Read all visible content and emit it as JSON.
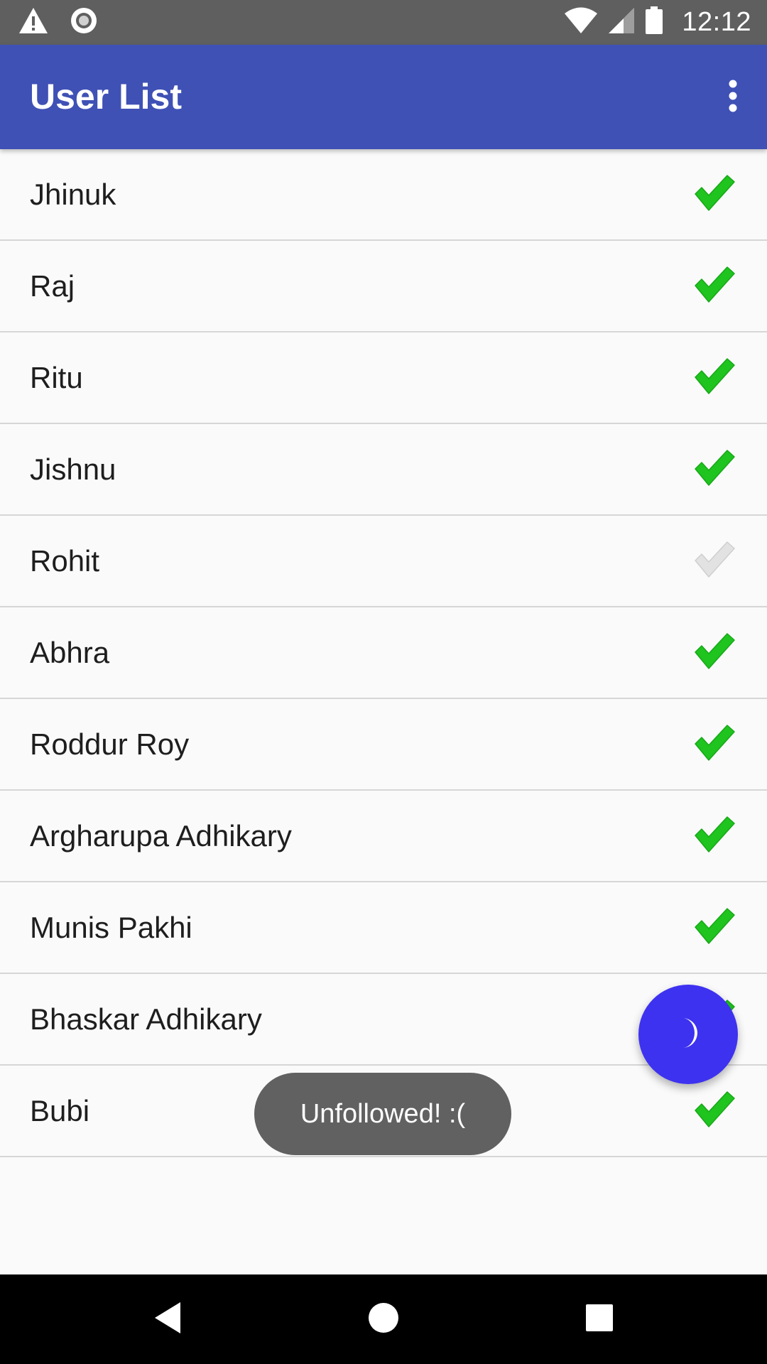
{
  "status_bar": {
    "time": "12:12",
    "icons": [
      "warning-icon",
      "record-icon",
      "wifi-icon",
      "signal-icon",
      "battery-icon"
    ]
  },
  "app_bar": {
    "title": "User List",
    "overflow_icon": "more-vert-icon"
  },
  "users": [
    {
      "name": "Jhinuk",
      "followed": true
    },
    {
      "name": "Raj",
      "followed": true
    },
    {
      "name": "Ritu",
      "followed": true
    },
    {
      "name": "Jishnu",
      "followed": true
    },
    {
      "name": "Rohit",
      "followed": false
    },
    {
      "name": "Abhra",
      "followed": true
    },
    {
      "name": "Roddur Roy",
      "followed": true
    },
    {
      "name": "Argharupa Adhikary",
      "followed": true
    },
    {
      "name": "Munis Pakhi",
      "followed": true
    },
    {
      "name": "Bhaskar Adhikary",
      "followed": true
    },
    {
      "name": "Bubi",
      "followed": true
    }
  ],
  "fab": {
    "icon": "moon-icon"
  },
  "toast": {
    "text": "Unfollowed! :("
  },
  "nav_bar": {
    "icons": [
      "back-icon",
      "home-icon",
      "recents-icon"
    ]
  },
  "colors": {
    "status_bar": "#5f5f5f",
    "app_bar": "#3f51b5",
    "check_followed": "#1fc41f",
    "check_unfollowed": "#e2e2e2",
    "fab": "#3d32f0",
    "toast": "#616161"
  }
}
